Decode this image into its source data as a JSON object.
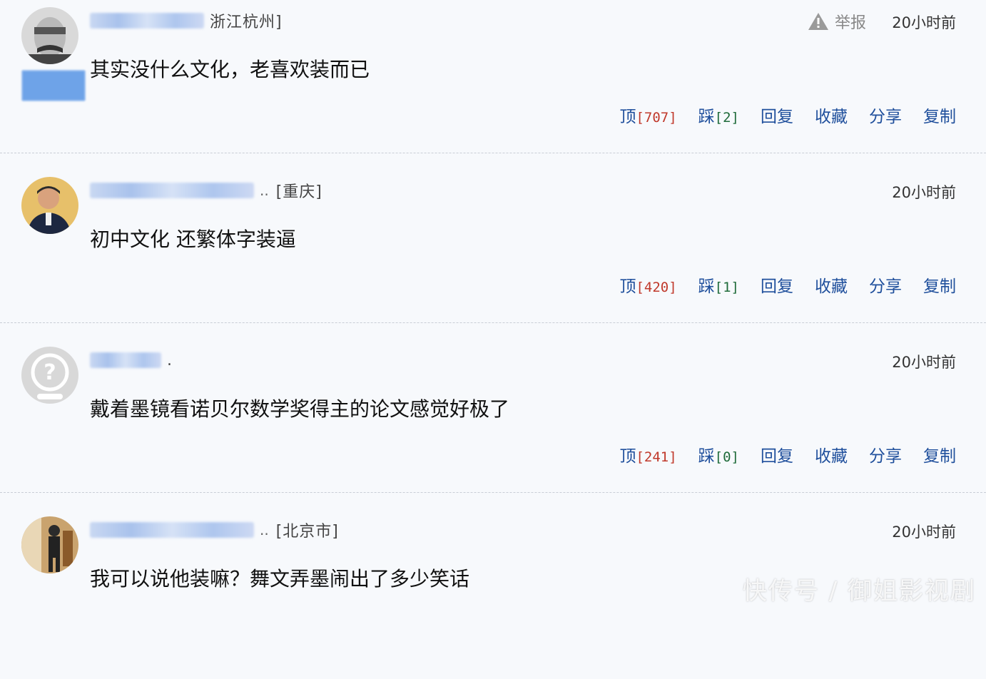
{
  "comments": [
    {
      "location": "浙江杭州]",
      "location_prefix": "",
      "report_label": "举报",
      "time": "20小时前",
      "text": "其实没什么文化，老喜欢装而已",
      "up_label": "顶",
      "up_count": "[707]",
      "down_label": "踩",
      "down_count": "[2]",
      "reply_label": "回复",
      "collect_label": "收藏",
      "share_label": "分享",
      "copy_label": "复制"
    },
    {
      "location": "[重庆]",
      "time": "20小时前",
      "text": "初中文化  还繁体字装逼",
      "up_label": "顶",
      "up_count": "[420]",
      "down_label": "踩",
      "down_count": "[1]",
      "reply_label": "回复",
      "collect_label": "收藏",
      "share_label": "分享",
      "copy_label": "复制"
    },
    {
      "location": ".",
      "time": "20小时前",
      "text": "戴着墨镜看诺贝尔数学奖得主的论文感觉好极了",
      "up_label": "顶",
      "up_count": "[241]",
      "down_label": "踩",
      "down_count": "[0]",
      "reply_label": "回复",
      "collect_label": "收藏",
      "share_label": "分享",
      "copy_label": "复制"
    },
    {
      "location": "[北京市]",
      "time": "20小时前",
      "text": "我可以说他装嘛？舞文弄墨闹出了多少笑话"
    }
  ],
  "watermark": "快传号 / 御姐影视剧",
  "colors": {
    "action_blue": "#1f4f9c",
    "count_red": "#c0392b",
    "count_green": "#1f6b3a",
    "background": "#f7f9fc"
  },
  "icons": {
    "report": "warning-triangle-icon",
    "default_avatar": "question-mark-avatar-icon"
  }
}
